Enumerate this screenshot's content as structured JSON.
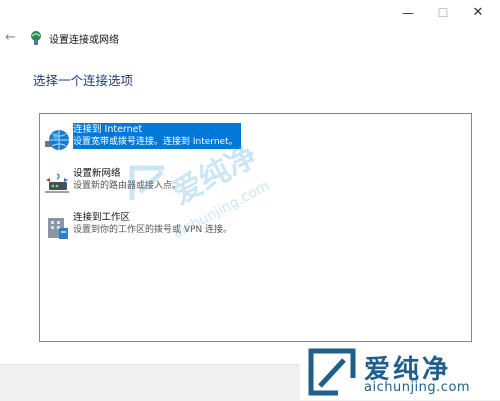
{
  "window": {
    "title": "设置连接或网络",
    "minimize_glyph": "—",
    "maximize_glyph": "☐",
    "close_glyph": "✕",
    "back_glyph": "←"
  },
  "page": {
    "heading": "选择一个连接选项"
  },
  "options": [
    {
      "title": "连接到 Internet",
      "desc": "设置宽带或拨号连接。连接到 Internet。",
      "icon": "globe-icon",
      "selected": true
    },
    {
      "title": "设置新网络",
      "desc": "设置新的路由器或接入点。",
      "icon": "router-icon",
      "selected": false
    },
    {
      "title": "连接到工作区",
      "desc": "设置到你的工作区的拨号或 VPN 连接。",
      "icon": "workplace-icon",
      "selected": false
    }
  ],
  "watermark": {
    "chinese": "爱纯净",
    "url": "aichunjing.com"
  },
  "colors": {
    "heading": "#1f3d80",
    "selection": "#0078d7",
    "watermark": "#1f5f8b"
  }
}
